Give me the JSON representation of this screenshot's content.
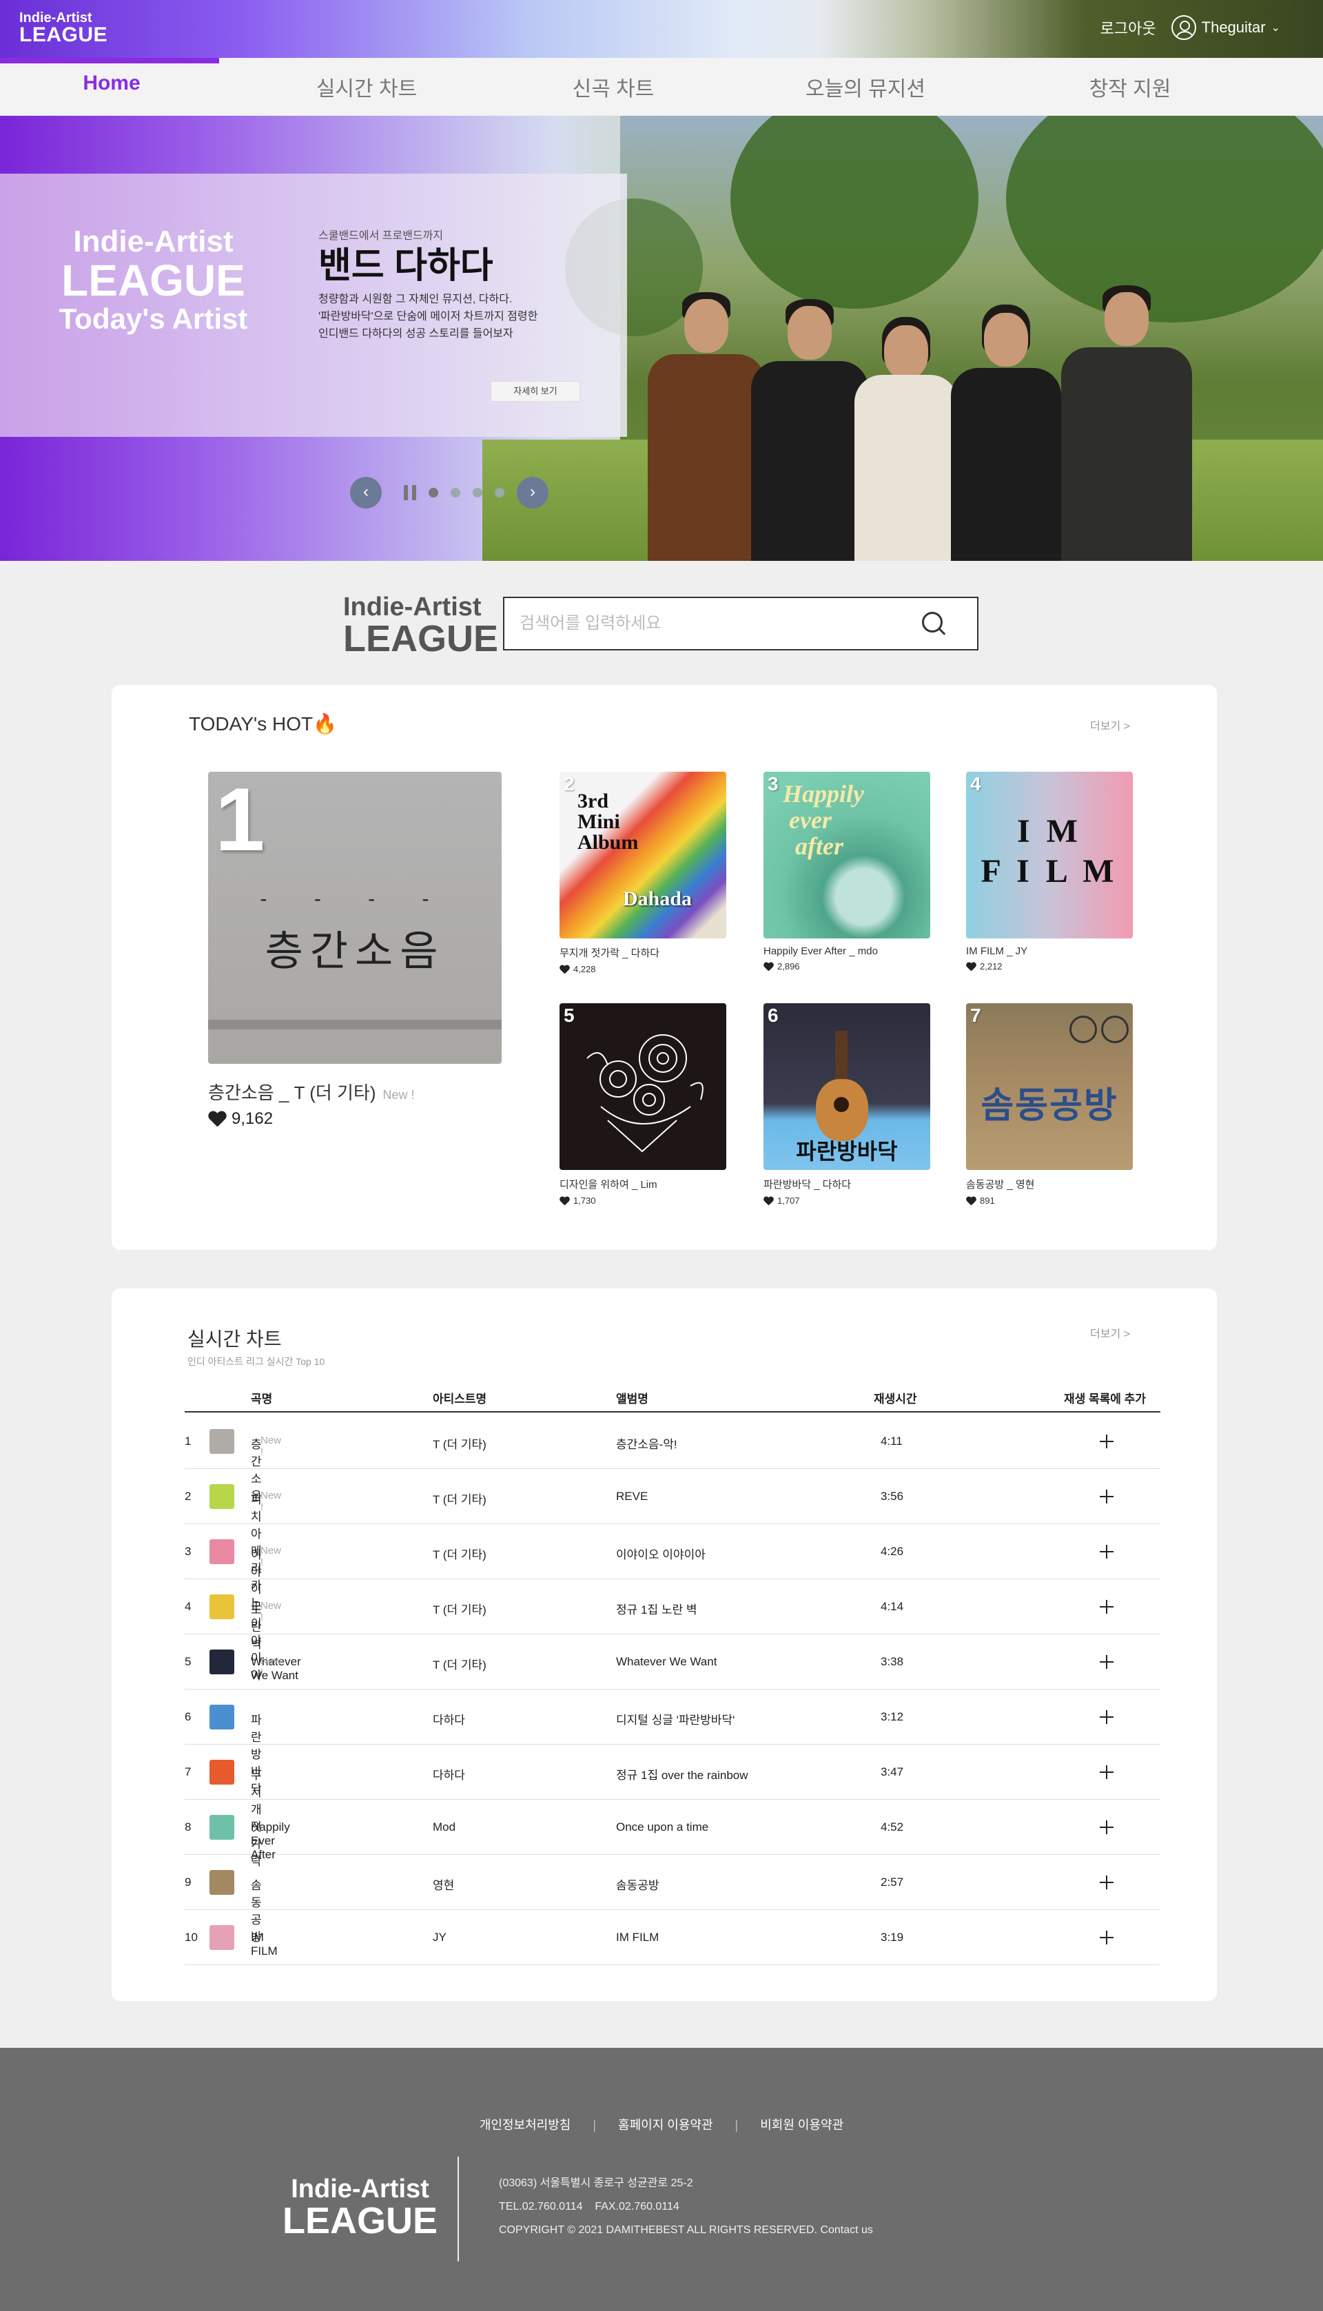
{
  "header": {
    "logo_line1": "Indie-Artist",
    "logo_line2": "LEAGUE",
    "logout_label": "로그아웃",
    "username": "Theguitar",
    "dropdown_glyph": "⌄"
  },
  "nav": {
    "tabs": [
      {
        "label": "Home",
        "active": true
      },
      {
        "label": "실시간 차트",
        "active": false
      },
      {
        "label": "신곡 차트",
        "active": false
      },
      {
        "label": "오늘의 뮤지션",
        "active": false
      },
      {
        "label": "창작 지원",
        "active": false
      }
    ],
    "accent_color": "#8a2be2"
  },
  "hero": {
    "brand_line1": "Indie-Artist",
    "brand_line2": "LEAGUE",
    "brand_line3": "Today's Artist",
    "kicker": "스쿨밴드에서 프로밴드까지",
    "title": "밴드 다하다",
    "desc_line1": "청량함과 시원함 그 자체인 뮤지션, 다하다.",
    "desc_line2": "'파란방바닥'으로 단숨에 메이저 차트까지 점령한",
    "desc_line3": "인디밴드 다하다의 성공 스토리를 들어보자",
    "more_button": "자세히 보기",
    "prev_glyph": "‹",
    "next_glyph": "›",
    "slide_count": 4,
    "active_slide": 1
  },
  "search": {
    "logo_line1": "Indie-Artist",
    "logo_line2": "LEAGUE",
    "placeholder": "검색어를 입력하세요"
  },
  "todays_hot": {
    "title": "TODAY's HOT",
    "title_emoji": "🔥",
    "more_label": "더보기 >",
    "top": {
      "rank": "1",
      "art_dashes": "- - - -",
      "art_text": "층간소음",
      "title": "층간소음 _ T (더 기타)",
      "new_label": "New !",
      "likes": "9,162"
    },
    "items": [
      {
        "rank": "2",
        "title": "무지개 젓가락 _ 다하다",
        "likes": "4,228",
        "art_line1": "3rd",
        "art_line2": "Mini",
        "art_line3": "Album",
        "art_line4": "Dahada"
      },
      {
        "rank": "3",
        "title": "Happily Ever After _ mdo",
        "likes": "2,896",
        "art_line1": "Happily",
        "art_line2": "ever",
        "art_line3": "after",
        "art_line4": ""
      },
      {
        "rank": "4",
        "title": "IM FILM _ JY",
        "likes": "2,212",
        "art_line1": "I  M",
        "art_line2": "F I L M",
        "art_line3": "",
        "art_line4": ""
      },
      {
        "rank": "5",
        "title": "디자인을 위하여 _ Lim",
        "likes": "1,730",
        "art_line1": "",
        "art_line2": "",
        "art_line3": "",
        "art_line4": ""
      },
      {
        "rank": "6",
        "title": "파란방바닥 _ 다하다",
        "likes": "1,707",
        "art_line1": "파란방바닥",
        "art_line2": "",
        "art_line3": "",
        "art_line4": ""
      },
      {
        "rank": "7",
        "title": "솜동공방 _ 영현",
        "likes": "891",
        "art_line1": "솜동공방",
        "art_line2": "",
        "art_line3": "",
        "art_line4": ""
      }
    ]
  },
  "realtime": {
    "title": "실시간 차트",
    "subtitle": "인디 아티스트 리그 실시간 Top 10",
    "more_label": "더보기 >",
    "columns": [
      "곡명",
      "아티스트명",
      "앨범명",
      "재생시간",
      "재생 목록에 추가"
    ],
    "rows": [
      {
        "rank": "1",
        "song": "층간소음",
        "new": "New !",
        "artist": "T (더 기타)",
        "album": "층간소음-악!",
        "time": "4:11",
        "thumb_color": "#b0aba6"
      },
      {
        "rank": "2",
        "song": "피치 아메리카노",
        "new": "New !",
        "artist": "T (더 기타)",
        "album": "REVE",
        "time": "3:56",
        "thumb_color": "#b7d64a"
      },
      {
        "rank": "3",
        "song": "이야이오 이야이아",
        "new": "New !",
        "artist": "T (더 기타)",
        "album": "이야이오 이야이아",
        "time": "4:26",
        "thumb_color": "#e98aa2"
      },
      {
        "rank": "4",
        "song": "노란 벽",
        "new": "New !",
        "artist": "T (더 기타)",
        "album": "정규 1집 노란 벽",
        "time": "4:14",
        "thumb_color": "#e9c43a"
      },
      {
        "rank": "5",
        "song": "Whatever We Want",
        "new": "New !",
        "artist": "T (더 기타)",
        "album": "Whatever We Want",
        "time": "3:38",
        "thumb_color": "#23273a"
      },
      {
        "rank": "6",
        "song": "파란방바닥",
        "new": "",
        "artist": "다하다",
        "album": "디지털 싱글 '파란방바닥'",
        "time": "3:12",
        "thumb_color": "#4c8fd0"
      },
      {
        "rank": "7",
        "song": "무지개 젓가락",
        "new": "",
        "artist": "다하다",
        "album": "정규 1집 over the rainbow",
        "time": "3:47",
        "thumb_color": "#e65a2d"
      },
      {
        "rank": "8",
        "song": "Happily Ever After",
        "new": "",
        "artist": "Mod",
        "album": "Once upon a time",
        "time": "4:52",
        "thumb_color": "#6ec1a8"
      },
      {
        "rank": "9",
        "song": "솜동공방",
        "new": "",
        "artist": "영현",
        "album": "솜동공방",
        "time": "2:57",
        "thumb_color": "#a38862"
      },
      {
        "rank": "10",
        "song": "IM FILM",
        "new": "",
        "artist": "JY",
        "album": "IM FILM",
        "time": "3:19",
        "thumb_color": "#e7a1b4"
      }
    ]
  },
  "footer": {
    "links": [
      "개인정보처리방침",
      "홈페이지 이용약관",
      "비회원 이용약관"
    ],
    "separator": "|",
    "logo_line1": "Indie-Artist",
    "logo_line2": "LEAGUE",
    "address": "(03063) 서울특별시 종로구 성균관로 25-2",
    "contact": "TEL.02.760.0114    FAX.02.760.0114",
    "copyright": "COPYRIGHT © 2021 DAMITHEBEST ALL RIGHTS RESERVED. Contact us"
  }
}
